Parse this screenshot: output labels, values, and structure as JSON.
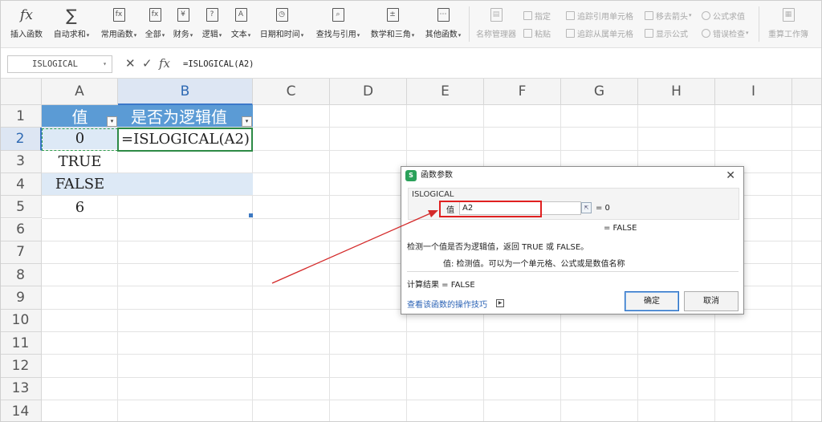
{
  "ribbon": {
    "insert_function": "插入函数",
    "autosum": "自动求和",
    "common_functions": "常用函数",
    "all": "全部",
    "financial": "财务",
    "logical": "逻辑",
    "text": "文本",
    "datetime": "日期和时间",
    "lookup": "查找与引用",
    "math": "数学和三角",
    "other": "其他函数",
    "name_manager": "名称管理器",
    "specify": "指定",
    "paste": "粘贴",
    "trace_precedents": "追踪引用单元格",
    "trace_dependents": "追踪从属单元格",
    "remove_arrows": "移去箭头",
    "show_formulas": "显示公式",
    "evaluate_formula": "公式求值",
    "error_checking": "错误检查",
    "recalc": "重算工作簿",
    "icon_fx": "fx",
    "icon_sum": "∑",
    "icon_yen": "¥",
    "icon_question": "?",
    "icon_text": "A"
  },
  "formula_bar": {
    "name_box": "ISLOGICAL",
    "cancel_glyph": "✕",
    "confirm_glyph": "✓",
    "fx_glyph": "fx",
    "formula": "=ISLOGICAL(A2)"
  },
  "sheet": {
    "columns": [
      "A",
      "B",
      "C",
      "D",
      "E",
      "F",
      "G",
      "H",
      "I"
    ],
    "rows": [
      "1",
      "2",
      "3",
      "4",
      "5",
      "6",
      "7",
      "8",
      "9",
      "10",
      "11",
      "12",
      "13",
      "14"
    ],
    "header_value": "值",
    "header_is_logical": "是否为逻辑值",
    "a2": "0",
    "a3": "TRUE",
    "a4": "FALSE",
    "a5": "6",
    "b2": "=ISLOGICAL(A2)"
  },
  "dialog": {
    "title": "函数参数",
    "app_icon": "S",
    "close": "✕",
    "function_name": "ISLOGICAL",
    "arg_label": "值",
    "arg_value": "A2",
    "arg_result": "= 0",
    "function_result": "= FALSE",
    "description": "检测一个值是否为逻辑值，返回 TRUE 或 FALSE。",
    "arg_description": "值:  检测值。可以为一个单元格、公式或是数值名称",
    "calc_result": "计算结果 = FALSE",
    "help_link": "查看该函数的操作技巧",
    "ok": "确定",
    "cancel": "取消"
  },
  "colors": {
    "table_header": "#5b9bd5",
    "band": "#dde9f6",
    "active_border": "#2d8a45",
    "highlight_box": "#e02020",
    "annotation_arrow": "#d42a2a"
  }
}
